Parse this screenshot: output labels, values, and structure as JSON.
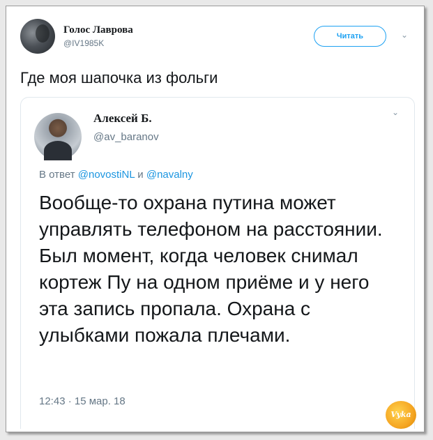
{
  "outer_tweet": {
    "author_name": "Голос Лаврова",
    "author_handle": "@IV1985K",
    "follow_label": "Читать",
    "text": "Где моя шапочка из фольги"
  },
  "quoted_tweet": {
    "author_name": "Алексей Б.",
    "author_handle": "@av_baranov",
    "reply_prefix": "В ответ ",
    "reply_mention_1": "@novostiNL",
    "reply_conj": " и ",
    "reply_mention_2": "@navalny",
    "text": "Вообще-то охрана путина может управлять телефоном на расстоянии. Был момент, когда человек снимал кортеж Пу на одном приёме и у него эта запись пропала. Охрана с улыбками пожала плечами.",
    "timestamp": "12:43 · 15 мар. 18"
  },
  "icons": {
    "outer_menu": "chevron-down-icon",
    "inner_menu": "chevron-down-icon"
  },
  "colors": {
    "accent": "#1da1f2",
    "mention": "#1b95e0",
    "muted": "#657786"
  }
}
